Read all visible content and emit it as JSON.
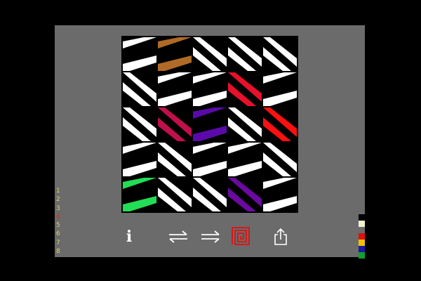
{
  "board": {
    "rows": 5,
    "cols": 5,
    "tiles": [
      [
        {
          "o": "A",
          "c": "#ffffff"
        },
        {
          "o": "A",
          "c": "#b06a28"
        },
        {
          "o": "B",
          "c": "#ffffff"
        },
        {
          "o": "B",
          "c": "#ffffff"
        },
        {
          "o": "B",
          "c": "#ffffff"
        }
      ],
      [
        {
          "o": "B",
          "c": "#ffffff"
        },
        {
          "o": "A",
          "c": "#ffffff"
        },
        {
          "o": "A",
          "c": "#ffffff"
        },
        {
          "o": "B",
          "c": "#e8102a"
        },
        {
          "o": "A",
          "c": "#ffffff"
        }
      ],
      [
        {
          "o": "B",
          "c": "#ffffff"
        },
        {
          "o": "B",
          "c": "#c0104c"
        },
        {
          "o": "A",
          "c": "#5a0aaa"
        },
        {
          "o": "B",
          "c": "#ffffff"
        },
        {
          "o": "B",
          "c": "#ff1010"
        }
      ],
      [
        {
          "o": "A",
          "c": "#ffffff"
        },
        {
          "o": "B",
          "c": "#ffffff"
        },
        {
          "o": "A",
          "c": "#ffffff"
        },
        {
          "o": "A",
          "c": "#ffffff"
        },
        {
          "o": "B",
          "c": "#ffffff"
        }
      ],
      [
        {
          "o": "A",
          "c": "#22dd55"
        },
        {
          "o": "B",
          "c": "#ffffff"
        },
        {
          "o": "B",
          "c": "#ffffff"
        },
        {
          "o": "B",
          "c": "#6a0aa0"
        },
        {
          "o": "A",
          "c": "#ffffff"
        }
      ]
    ]
  },
  "toolbar": {
    "info_label": "i",
    "swap_icon": "swap-arrows-icon",
    "forward_icon": "double-right-arrow-icon",
    "spiral_icon": "spiral-icon",
    "share_icon": "share-icon",
    "spiral_color": "#e01010"
  },
  "levels": [
    {
      "label": "1",
      "color": "#e0d060"
    },
    {
      "label": "2",
      "color": "#e0d060"
    },
    {
      "label": "3",
      "color": "#e0d060"
    },
    {
      "label": "4",
      "color": "#c83030"
    },
    {
      "label": "5",
      "color": "#e0d060"
    },
    {
      "label": "6",
      "color": "#e0d060"
    },
    {
      "label": "7",
      "color": "#e0d060"
    },
    {
      "label": "8",
      "color": "#e0d060"
    }
  ],
  "palette": [
    "#000000",
    "#f4f0d0",
    "#6b6b6b",
    "#e01010",
    "#f0c000",
    "#1a1aa0",
    "#10a030"
  ],
  "colors": {
    "background": "#000000",
    "panel": "#6b6b6b",
    "board_border": "#000000"
  }
}
